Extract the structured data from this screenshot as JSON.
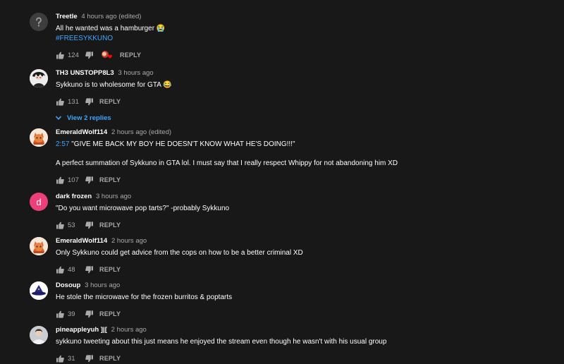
{
  "comments": [
    {
      "author": "Treetle",
      "time": "4 hours ago (edited)",
      "text": "All he wanted was a hamburger 😭",
      "hashtag": "#FREESYKKUNO",
      "likes": "124",
      "reply_label": "REPLY",
      "avatar": "default-user-avatar",
      "heart": true
    },
    {
      "author": "TH3 UNSTOPP8L3",
      "time": "3 hours ago",
      "text": "Sykkuno is to wholesome for GTA 😂",
      "likes": "131",
      "reply_label": "REPLY",
      "view_replies": "View 2 replies",
      "avatar": "anime-character-avatar"
    },
    {
      "author": "EmeraldWolf114",
      "time": "2 hours ago (edited)",
      "timestamp_link": "2:57",
      "text": " \"GIVE ME BACK MY BOY HE DOESN'T KNOW WHAT HE'S DOING!!!\"",
      "text2": "A perfect summation of Sykkuno in GTA lol. I must say that I really respect Whippy for not abandoning him XD",
      "likes": "107",
      "reply_label": "REPLY",
      "avatar": "orange-cat-avatar"
    },
    {
      "author": "dark frozen",
      "time": "3 hours ago",
      "text": "\"Do you want microwave pop tarts?\" -probably Sykkuno",
      "likes": "53",
      "reply_label": "REPLY",
      "avatar_letter": "d",
      "avatar_color": "#ec407a"
    },
    {
      "author": "EmeraldWolf114",
      "time": "2 hours ago",
      "text": "Only Sykkuno could get advice from the cops on how to be a better criminal XD",
      "likes": "48",
      "reply_label": "REPLY",
      "avatar": "orange-cat-avatar"
    },
    {
      "author": "Dosoup",
      "time": "3 hours ago",
      "text": "He stole the microwave for the frozen burritos & poptarts",
      "likes": "39",
      "reply_label": "REPLY",
      "avatar": "wizard-hat-avatar"
    },
    {
      "author": "pineappleyuh ]|[",
      "time": "2 hours ago",
      "text": "sykkuno tweeting about this just means he enjoyed the stream even though he wasn't with his usual group",
      "likes": "31",
      "reply_label": "REPLY",
      "avatar": "photo-avatar"
    }
  ],
  "colors": {
    "background": "#181818",
    "link": "#3ea6ff",
    "secondary_text": "#aaaaaa"
  }
}
